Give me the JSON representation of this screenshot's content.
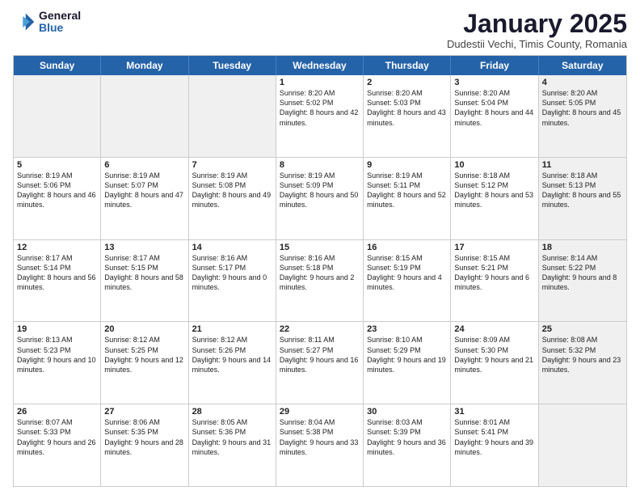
{
  "header": {
    "logo_general": "General",
    "logo_blue": "Blue",
    "month_title": "January 2025",
    "subtitle": "Dudestii Vechi, Timis County, Romania"
  },
  "weekdays": [
    "Sunday",
    "Monday",
    "Tuesday",
    "Wednesday",
    "Thursday",
    "Friday",
    "Saturday"
  ],
  "weeks": [
    [
      {
        "day": "",
        "sunrise": "",
        "sunset": "",
        "daylight": "",
        "shaded": true
      },
      {
        "day": "",
        "sunrise": "",
        "sunset": "",
        "daylight": "",
        "shaded": true
      },
      {
        "day": "",
        "sunrise": "",
        "sunset": "",
        "daylight": "",
        "shaded": true
      },
      {
        "day": "1",
        "sunrise": "Sunrise: 8:20 AM",
        "sunset": "Sunset: 5:02 PM",
        "daylight": "Daylight: 8 hours and 42 minutes."
      },
      {
        "day": "2",
        "sunrise": "Sunrise: 8:20 AM",
        "sunset": "Sunset: 5:03 PM",
        "daylight": "Daylight: 8 hours and 43 minutes."
      },
      {
        "day": "3",
        "sunrise": "Sunrise: 8:20 AM",
        "sunset": "Sunset: 5:04 PM",
        "daylight": "Daylight: 8 hours and 44 minutes."
      },
      {
        "day": "4",
        "sunrise": "Sunrise: 8:20 AM",
        "sunset": "Sunset: 5:05 PM",
        "daylight": "Daylight: 8 hours and 45 minutes.",
        "shaded": true
      }
    ],
    [
      {
        "day": "5",
        "sunrise": "Sunrise: 8:19 AM",
        "sunset": "Sunset: 5:06 PM",
        "daylight": "Daylight: 8 hours and 46 minutes."
      },
      {
        "day": "6",
        "sunrise": "Sunrise: 8:19 AM",
        "sunset": "Sunset: 5:07 PM",
        "daylight": "Daylight: 8 hours and 47 minutes."
      },
      {
        "day": "7",
        "sunrise": "Sunrise: 8:19 AM",
        "sunset": "Sunset: 5:08 PM",
        "daylight": "Daylight: 8 hours and 49 minutes."
      },
      {
        "day": "8",
        "sunrise": "Sunrise: 8:19 AM",
        "sunset": "Sunset: 5:09 PM",
        "daylight": "Daylight: 8 hours and 50 minutes."
      },
      {
        "day": "9",
        "sunrise": "Sunrise: 8:19 AM",
        "sunset": "Sunset: 5:11 PM",
        "daylight": "Daylight: 8 hours and 52 minutes."
      },
      {
        "day": "10",
        "sunrise": "Sunrise: 8:18 AM",
        "sunset": "Sunset: 5:12 PM",
        "daylight": "Daylight: 8 hours and 53 minutes."
      },
      {
        "day": "11",
        "sunrise": "Sunrise: 8:18 AM",
        "sunset": "Sunset: 5:13 PM",
        "daylight": "Daylight: 8 hours and 55 minutes.",
        "shaded": true
      }
    ],
    [
      {
        "day": "12",
        "sunrise": "Sunrise: 8:17 AM",
        "sunset": "Sunset: 5:14 PM",
        "daylight": "Daylight: 8 hours and 56 minutes."
      },
      {
        "day": "13",
        "sunrise": "Sunrise: 8:17 AM",
        "sunset": "Sunset: 5:15 PM",
        "daylight": "Daylight: 8 hours and 58 minutes."
      },
      {
        "day": "14",
        "sunrise": "Sunrise: 8:16 AM",
        "sunset": "Sunset: 5:17 PM",
        "daylight": "Daylight: 9 hours and 0 minutes."
      },
      {
        "day": "15",
        "sunrise": "Sunrise: 8:16 AM",
        "sunset": "Sunset: 5:18 PM",
        "daylight": "Daylight: 9 hours and 2 minutes."
      },
      {
        "day": "16",
        "sunrise": "Sunrise: 8:15 AM",
        "sunset": "Sunset: 5:19 PM",
        "daylight": "Daylight: 9 hours and 4 minutes."
      },
      {
        "day": "17",
        "sunrise": "Sunrise: 8:15 AM",
        "sunset": "Sunset: 5:21 PM",
        "daylight": "Daylight: 9 hours and 6 minutes."
      },
      {
        "day": "18",
        "sunrise": "Sunrise: 8:14 AM",
        "sunset": "Sunset: 5:22 PM",
        "daylight": "Daylight: 9 hours and 8 minutes.",
        "shaded": true
      }
    ],
    [
      {
        "day": "19",
        "sunrise": "Sunrise: 8:13 AM",
        "sunset": "Sunset: 5:23 PM",
        "daylight": "Daylight: 9 hours and 10 minutes."
      },
      {
        "day": "20",
        "sunrise": "Sunrise: 8:12 AM",
        "sunset": "Sunset: 5:25 PM",
        "daylight": "Daylight: 9 hours and 12 minutes."
      },
      {
        "day": "21",
        "sunrise": "Sunrise: 8:12 AM",
        "sunset": "Sunset: 5:26 PM",
        "daylight": "Daylight: 9 hours and 14 minutes."
      },
      {
        "day": "22",
        "sunrise": "Sunrise: 8:11 AM",
        "sunset": "Sunset: 5:27 PM",
        "daylight": "Daylight: 9 hours and 16 minutes."
      },
      {
        "day": "23",
        "sunrise": "Sunrise: 8:10 AM",
        "sunset": "Sunset: 5:29 PM",
        "daylight": "Daylight: 9 hours and 19 minutes."
      },
      {
        "day": "24",
        "sunrise": "Sunrise: 8:09 AM",
        "sunset": "Sunset: 5:30 PM",
        "daylight": "Daylight: 9 hours and 21 minutes."
      },
      {
        "day": "25",
        "sunrise": "Sunrise: 8:08 AM",
        "sunset": "Sunset: 5:32 PM",
        "daylight": "Daylight: 9 hours and 23 minutes.",
        "shaded": true
      }
    ],
    [
      {
        "day": "26",
        "sunrise": "Sunrise: 8:07 AM",
        "sunset": "Sunset: 5:33 PM",
        "daylight": "Daylight: 9 hours and 26 minutes."
      },
      {
        "day": "27",
        "sunrise": "Sunrise: 8:06 AM",
        "sunset": "Sunset: 5:35 PM",
        "daylight": "Daylight: 9 hours and 28 minutes."
      },
      {
        "day": "28",
        "sunrise": "Sunrise: 8:05 AM",
        "sunset": "Sunset: 5:36 PM",
        "daylight": "Daylight: 9 hours and 31 minutes."
      },
      {
        "day": "29",
        "sunrise": "Sunrise: 8:04 AM",
        "sunset": "Sunset: 5:38 PM",
        "daylight": "Daylight: 9 hours and 33 minutes."
      },
      {
        "day": "30",
        "sunrise": "Sunrise: 8:03 AM",
        "sunset": "Sunset: 5:39 PM",
        "daylight": "Daylight: 9 hours and 36 minutes."
      },
      {
        "day": "31",
        "sunrise": "Sunrise: 8:01 AM",
        "sunset": "Sunset: 5:41 PM",
        "daylight": "Daylight: 9 hours and 39 minutes."
      },
      {
        "day": "",
        "sunrise": "",
        "sunset": "",
        "daylight": "",
        "shaded": true
      }
    ]
  ]
}
